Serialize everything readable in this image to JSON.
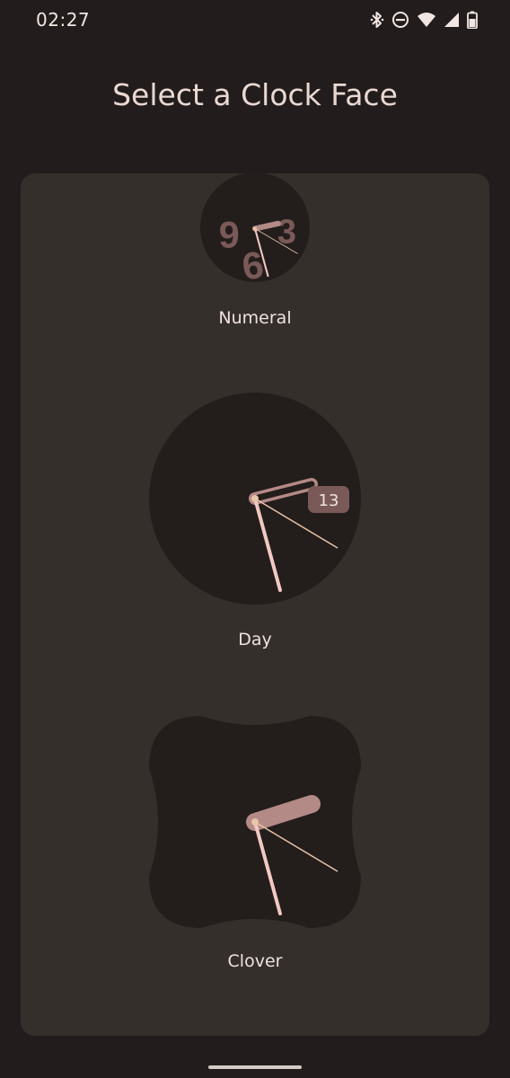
{
  "status_bar": {
    "time": "02:27",
    "icons": [
      "bluetooth-icon",
      "do-not-disturb-icon",
      "wifi-icon",
      "cell-signal-icon",
      "battery-icon"
    ]
  },
  "title": "Select a Clock Face",
  "faces": [
    {
      "id": "numeral",
      "label": "Numeral",
      "shape": "circle"
    },
    {
      "id": "day",
      "label": "Day",
      "shape": "circle",
      "date": "13"
    },
    {
      "id": "clover",
      "label": "Clover",
      "shape": "clover"
    }
  ],
  "colors": {
    "background": "#221d1c",
    "card": "#352f2c",
    "face": "#231d1c",
    "accent": "#b48a86",
    "hand": "#f2c8c2",
    "second_hand": "#e8c4a8",
    "text": "#eee2dd"
  }
}
